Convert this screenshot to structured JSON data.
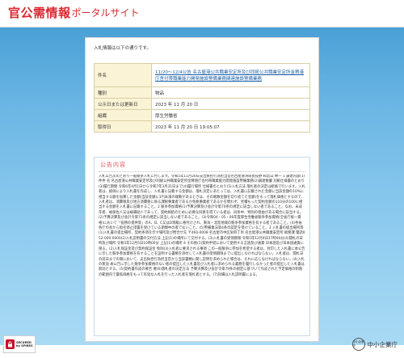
{
  "header": {
    "logo_main": "官公需情報",
    "logo_sub": "ポータルサイト"
  },
  "notice": {
    "intro": "入札情報は以下の通りです。"
  },
  "details": [
    {
      "label": "件名",
      "value": "11/20～12/4公告 名古屋港公共職業安定所及び同統公共職業安定所金稗港庁舎付帯職業能力開発施設警備業務関連施設警備業務"
    },
    {
      "label": "種別",
      "value": "物品"
    },
    {
      "label": "公示日または更新日",
      "value": "2023 年 11 月 20 日"
    },
    {
      "label": "組織",
      "value": "厚生労働省"
    },
    {
      "label": "取得日",
      "value": "2023 年 11 月 20 日 19:05:07"
    }
  ],
  "content": {
    "title": "公告内容",
    "text": "入札公告次のとおり一般競争入札に付します。令和5年11月20日支出負担行為担当官名古屋港湾局長技野 和宏山 林一 1 調達内容(1)件件 名 名古屋港公共職業安定所及び同統公共職業安定所金稗港庁舎付帯職業能力開発施設警備業務(2)調達数量 別紙仕様書のとおり(3)履行期間 令和6年4月1日から令和7年3月31日まで(4)履行場所 仕様書のとおり(5)入札方法 落札者の決定は総価で行います。入札者は、総価により入札書を作成し、入札書に記載する金額は、落札決定にあたっては、入札書に記載された金額に当該金額の10%に相当する額を加算した金額(当該金額に1円未満の端数があるときは、その端数金額を切り捨てた金額)をもって落札価格とするので、入札者は、消費税及び地方消費税に係る課税事業者であるか免税事業者であるかを問わず、見積もった契約金額の110分の100に相当する金額を入札書に記載すること。2 競争参加資格(1)予算決算及び会計令第70条の規定に該当しない者であること。なお、未成年者、被保佐人又は被補助人であって、契約締結のために必要な同意を得ている者は、同条中、特別の理由がある場合に該当する。(2)予算決算及び会計令第71条の規定に該当しない者であること。(3)令和04・05・06年度厚生労働省競争参加資格(全省庁統一資格)において「役務の提供等」のA、B、C又はD等級に格付けされ、東海・北陸地域の競争参加資格を有する者であること。(4)各省各庁の長から指名停止措置を受けている期間中の者でないこと。(5)警備業法第4条の認定を受けていること。3 入札書の提出場所等(1)入札書の提出場所、契約条項を示す場所及び問合せ先 〒460-0008 名古屋市中区栄四丁目 名古屋港公共職業安定所 総務課 電話052-000-0000(2)入札説明書の交付方法 上記(1)の場所にて交付する。(3)入札書の受領期限 令和5年12月4日17時00分(4)開札の日時及び場所 令和5年12月5日10時00分 上記(1)の場所 4 その他(1)契約手続において使用する言語及び通貨 日本語及び日本国通貨に限る。(2)入札保証金及び契約保証金 免除(3)入札者に要求される事項 この一般競争に参加を希望する者は、封印した入札書に本公告に示した競争参加資格を有することを証明する書類を添付して入札書の受領期限までに提出しなければならない。入札者は、開札日の前日までの間において、支出負担行為担当官から当該書類に関し説明を求められた場合は、それに応じなければならない。(4)入札の無効 本公告に示した競争参加資格のない者の提出した入札書及び入札者に求められる義務を履行しなかった者の提出した入札書は無効とする。(5)契約書作成の要否 要(6)落札者の決定方法 予算決算及び会計令第79条の規定に基づいて作成された予定価格の制限の範囲内で最低価格をもって有効な入札を行った入札者を落札者とする。(7)詳細は入札説明書による。"
  },
  "footer": {
    "badge_line1": "SECURED",
    "badge_line2": "by SPIRES",
    "brand_icon_text": "中小企業庁",
    "brand_name": "中小企業庁"
  },
  "colors": {
    "brand_red": "#d9282f",
    "table_header_bg": "#fbf3d5",
    "link": "#1b5fa6",
    "section_title": "#e05560",
    "stage_top": "#4aa0d6",
    "stage_bottom": "#a9daf4"
  }
}
